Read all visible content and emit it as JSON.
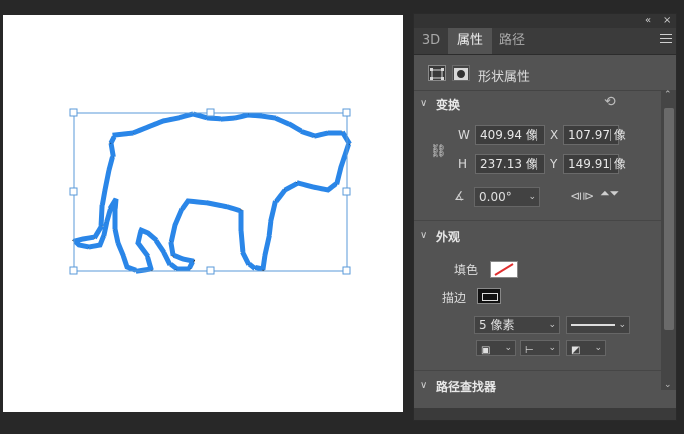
{
  "panel": {
    "tabs": [
      {
        "label": "3D"
      },
      {
        "label": "属性"
      },
      {
        "label": "路径"
      }
    ],
    "title_icons": {
      "collapse": "«",
      "close": "×"
    },
    "header_title": "形状属性",
    "transform": {
      "title": "变换",
      "w_label": "W",
      "w_value": "409.94 像",
      "x_label": "X",
      "x_value": "107.97 像",
      "h_label": "H",
      "h_value": "237.13 像",
      "y_label": "Y",
      "y_value": "149.91 像",
      "angle_value": "0.00°"
    },
    "appearance": {
      "title": "外观",
      "fill_label": "填色",
      "stroke_label": "描边",
      "stroke_width": "5 像素"
    },
    "next_section": "路径查找器"
  },
  "colors": {
    "selection": "#4a90d9",
    "anchors": "#1e7ee6",
    "panel_bg": "#535353",
    "accent_red": "#e03030"
  }
}
